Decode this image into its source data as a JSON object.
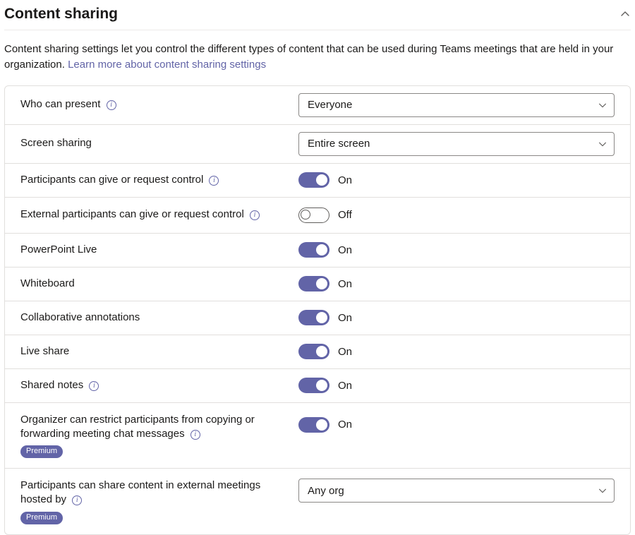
{
  "header": {
    "title": "Content sharing"
  },
  "description": {
    "text_before": "Content sharing settings let you control the different types of content that can be used during Teams meetings that are held in your organization. ",
    "link_text": "Learn more about content sharing settings"
  },
  "labels": {
    "on": "On",
    "off": "Off",
    "premium": "Premium"
  },
  "rows": {
    "who_can_present": {
      "label": "Who can present",
      "info": true,
      "value": "Everyone"
    },
    "screen_sharing": {
      "label": "Screen sharing",
      "info": false,
      "value": "Entire screen"
    },
    "give_request_control": {
      "label": "Participants can give or request control",
      "info": true,
      "on": true
    },
    "external_give_request_control": {
      "label": "External participants can give or request control",
      "info": true,
      "on": false
    },
    "powerpoint_live": {
      "label": "PowerPoint Live",
      "info": false,
      "on": true
    },
    "whiteboard": {
      "label": "Whiteboard",
      "info": false,
      "on": true
    },
    "collaborative_annotations": {
      "label": "Collaborative annotations",
      "info": false,
      "on": true
    },
    "live_share": {
      "label": "Live share",
      "info": false,
      "on": true
    },
    "shared_notes": {
      "label": "Shared notes",
      "info": true,
      "on": true
    },
    "restrict_copy_forward": {
      "label": "Organizer can restrict participants from copying or forwarding meeting chat messages",
      "info": true,
      "on": true,
      "premium": true
    },
    "share_external": {
      "label": "Participants can share content in external meetings hosted by",
      "info": true,
      "value": "Any org",
      "premium": true
    }
  }
}
